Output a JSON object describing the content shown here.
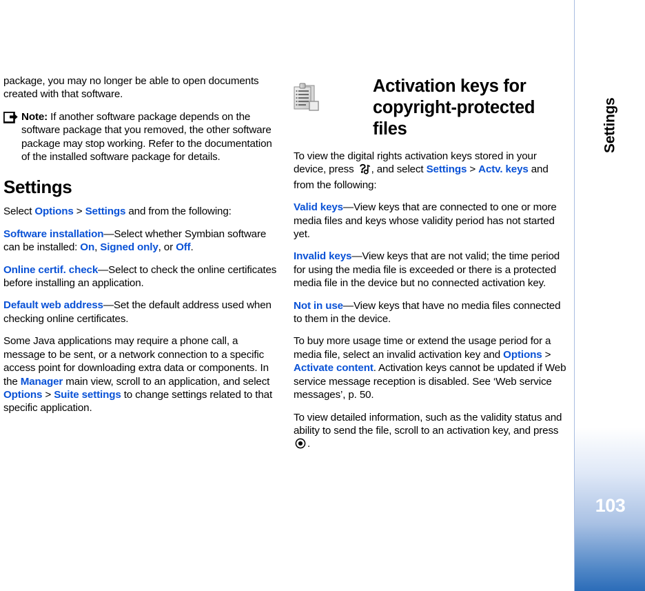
{
  "page": {
    "number": "103",
    "tab_label": "Settings",
    "accent_link_color": "#0A52D6",
    "tab_gradient_bottom_color": "#2B6CB8",
    "tab_border_color": "#A8BDE0"
  },
  "left_column": {
    "continued_paragraph": "package, you may no longer be able to open documents created with that software.",
    "note": {
      "icon": "note-arrow-icon",
      "label": "Note:",
      "text": " If another software package depends on the software package that you removed, the other software package may stop working. Refer to the documentation of the installed software package for details."
    },
    "section_heading": "Settings",
    "select_intro": {
      "pre": "Select ",
      "link1": "Options",
      "sep": " > ",
      "link2": "Settings",
      "post": " and from the following:"
    },
    "software_installation": {
      "term": "Software installation",
      "text_1": "—Select whether Symbian software can be installed: ",
      "opt1": "On",
      "sep1": ", ",
      "opt2": "Signed only",
      "sep2": ", or ",
      "opt3": "Off",
      "text_2": "."
    },
    "online_certif_check": {
      "term": "Online certif. check",
      "text": "—Select to check the online certificates before installing an application."
    },
    "default_web_address": {
      "term": "Default web address",
      "text": "—Set the default address used when checking online certificates."
    },
    "java_paragraph": {
      "part1": "Some Java applications may require a phone call, a message to be sent, or a network connection to a specific access point for downloading extra data or components. In the ",
      "link1": "Manager",
      "part2": " main view, scroll to an application, and select ",
      "link2": "Options",
      "sep": " > ",
      "link3": "Suite settings",
      "part3": " to change settings related to that specific application."
    }
  },
  "right_column": {
    "chapter": {
      "icon": "document-clipboard-icon",
      "title_line1": "Activation keys for",
      "title_line2": "copyright-protected files"
    },
    "intro": {
      "part1": "To view the digital rights activation keys stored in your device, press ",
      "icon": "menu-key-icon",
      "part2": ", and select ",
      "link1": "Settings",
      "sep": " > ",
      "link2": "Actv. keys",
      "part3": " and from the following:"
    },
    "valid_keys": {
      "term": "Valid keys",
      "text": "—View keys that are connected to one or more media files and keys whose validity period has not started yet."
    },
    "invalid_keys": {
      "term": "Invalid keys",
      "text": "—View keys that are not valid; the time period for using the media file is exceeded or there is a protected media file in the device but no connected activation key."
    },
    "not_in_use": {
      "term": "Not in use",
      "text": "—View keys that have no media files connected to them in the device."
    },
    "buy_usage": {
      "part1": "To buy more usage time or extend the usage period for a media file, select an invalid activation key and ",
      "link1": "Options",
      "sep": " > ",
      "link2": "Activate content",
      "part2": ". Activation keys cannot be updated if Web service message reception is disabled. See ‘Web service messages’, p. 50."
    },
    "detailed_info": {
      "part1": "To view detailed information, such as the validity status and ability to send the file, scroll to an activation key, and press ",
      "icon": "scroll-select-key-icon",
      "part2": "."
    }
  }
}
